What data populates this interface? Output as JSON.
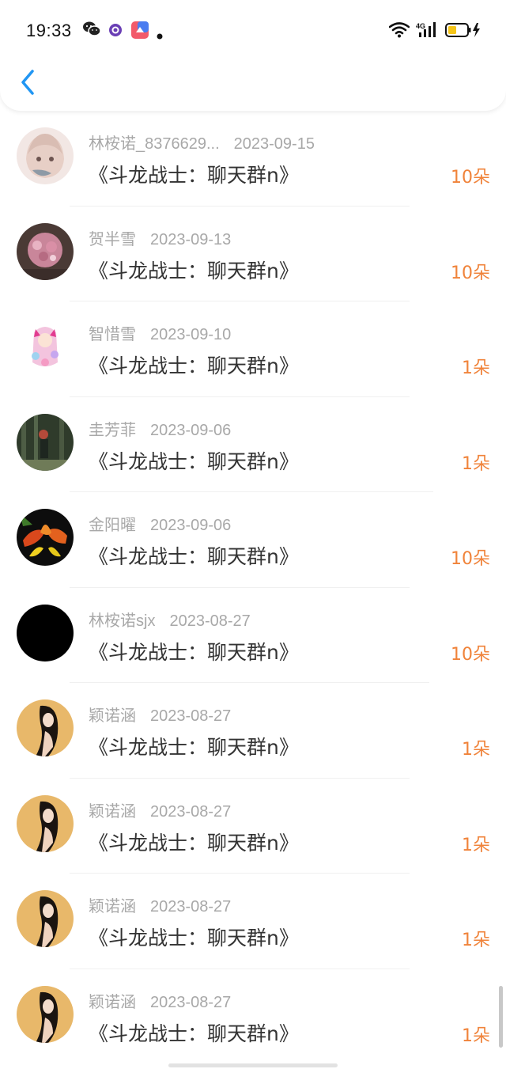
{
  "status_bar": {
    "time": "19:33",
    "network": "4G"
  },
  "nav": {
    "back_icon": "chevron-left-icon"
  },
  "colors": {
    "accent": "#2196f3",
    "amount": "#f0833a",
    "meta": "#a8a8a8",
    "title": "#333333"
  },
  "gifts": [
    {
      "name": "林桉诺_8376629...",
      "date": "2023-09-15",
      "title": "《斗龙战士：聊天群n》",
      "amount": "10朵"
    },
    {
      "name": "贺半雪",
      "date": "2023-09-13",
      "title": "《斗龙战士：聊天群n》",
      "amount": "10朵"
    },
    {
      "name": "智惜雪",
      "date": "2023-09-10",
      "title": "《斗龙战士：聊天群n》",
      "amount": "1朵"
    },
    {
      "name": "圭芳菲",
      "date": "2023-09-06",
      "title": "《斗龙战士：聊天群n》",
      "amount": "1朵"
    },
    {
      "name": "金阳曜",
      "date": "2023-09-06",
      "title": "《斗龙战士：聊天群n》",
      "amount": "10朵"
    },
    {
      "name": "林桉诺sjx",
      "date": "2023-08-27",
      "title": "《斗龙战士：聊天群n》",
      "amount": "10朵"
    },
    {
      "name": "颖诺涵",
      "date": "2023-08-27",
      "title": "《斗龙战士：聊天群n》",
      "amount": "1朵"
    },
    {
      "name": "颖诺涵",
      "date": "2023-08-27",
      "title": "《斗龙战士：聊天群n》",
      "amount": "1朵"
    },
    {
      "name": "颖诺涵",
      "date": "2023-08-27",
      "title": "《斗龙战士：聊天群n》",
      "amount": "1朵"
    },
    {
      "name": "颖诺涵",
      "date": "2023-08-27",
      "title": "《斗龙战士：聊天群n》",
      "amount": "1朵"
    }
  ]
}
